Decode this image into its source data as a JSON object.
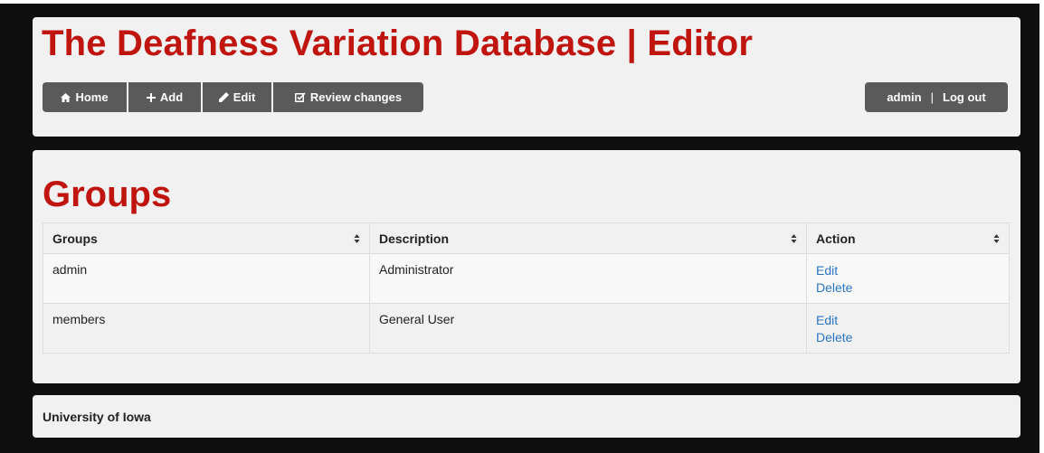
{
  "header": {
    "title": "The Deafness Variation Database | Editor",
    "nav": {
      "home_label": "Home",
      "add_label": "Add",
      "edit_label": "Edit",
      "review_label": "Review changes"
    },
    "user": {
      "username": "admin",
      "separator": "|",
      "logout_label": "Log out"
    }
  },
  "main": {
    "heading": "Groups",
    "table": {
      "columns": [
        "Groups",
        "Description",
        "Action"
      ],
      "rows": [
        {
          "group": "admin",
          "description": "Administrator",
          "actions": [
            "Edit",
            "Delete"
          ]
        },
        {
          "group": "members",
          "description": "General User",
          "actions": [
            "Edit",
            "Delete"
          ]
        }
      ]
    }
  },
  "footer": {
    "text": "University of Iowa"
  },
  "colors": {
    "brand_red": "#c0150f",
    "button_gray": "#5a5a5a",
    "panel_bg": "#f1f1f1",
    "link_blue": "#2a76c6"
  },
  "icons": {
    "home": "home-icon",
    "add": "plus-icon",
    "edit": "pencil-icon",
    "review": "check-square-icon",
    "sort": "sort-icon"
  }
}
